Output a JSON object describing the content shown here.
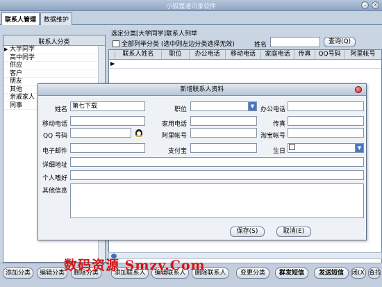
{
  "window": {
    "title": "小狐狸通讯录软件",
    "min": "–",
    "close": "×"
  },
  "tabs": [
    {
      "label": "联系人管理"
    },
    {
      "label": "数据维护"
    }
  ],
  "left": {
    "header": "联系人分类",
    "categories": [
      "大学同学",
      "高中同学",
      "供应",
      "客户",
      "朋友",
      "其他",
      "亲戚家人",
      "同事"
    ]
  },
  "right": {
    "label": "选定分类[大学同学]联系人列举",
    "list_all": "全部列举分类 (选中则左边分类选择无效)",
    "name_label": "姓名",
    "name_value": "",
    "query": "查询(Q)",
    "columns": [
      "联系人姓名",
      "职位",
      "办公电话",
      "移动电话",
      "家庭电话",
      "传真",
      "QQ号码",
      "阿里帐号"
    ]
  },
  "dialog": {
    "title": "新增联系人资料",
    "fields": {
      "name": {
        "label": "姓名",
        "value": "第七下载"
      },
      "title": {
        "label": "职位",
        "value": ""
      },
      "office": {
        "label": "办公电话",
        "value": ""
      },
      "mobile": {
        "label": "移动电话",
        "value": ""
      },
      "home": {
        "label": "家用电话",
        "value": ""
      },
      "fax": {
        "label": "传真",
        "value": ""
      },
      "qq": {
        "label": "QQ  号码",
        "value": ""
      },
      "ali": {
        "label": "阿里帐号",
        "value": ""
      },
      "taobao": {
        "label": "淘宝帐号",
        "value": ""
      },
      "email": {
        "label": "电子邮件",
        "value": ""
      },
      "alipay": {
        "label": "支付宝",
        "value": ""
      },
      "birthday": {
        "label": "生日",
        "value": ""
      },
      "address": {
        "label": "详细地址",
        "value": ""
      },
      "hobby": {
        "label": "个人嗜好",
        "value": ""
      },
      "other": {
        "label": "其他信息",
        "value": ""
      }
    },
    "save": "保存(S)",
    "cancel": "取消(E)"
  },
  "bottom": {
    "buttons": [
      "添加分类",
      "编辑分类",
      "删除分类",
      "添加联系人",
      "编辑联系人",
      "删除联系人",
      "变更分类",
      "群发短信",
      "发送短信",
      "闭(X)",
      "查找"
    ]
  },
  "watermark": "数码资源  Smzy.Com"
}
